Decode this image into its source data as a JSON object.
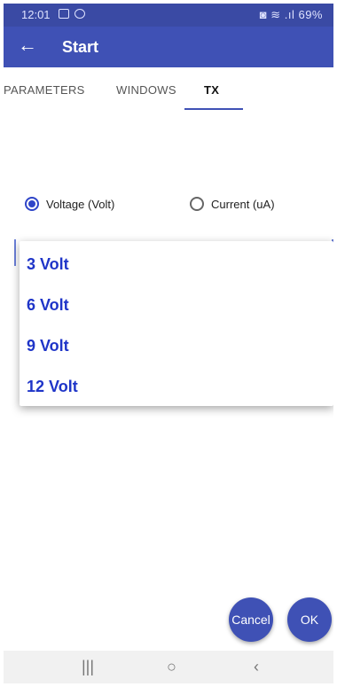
{
  "status_bar": {
    "time": "12:01",
    "right_text": "◙ ≋ .ıl 69%"
  },
  "app_bar": {
    "back_icon": "←",
    "title": "Start"
  },
  "tabs": [
    {
      "label": "PARAMETERS",
      "active": false
    },
    {
      "label": "WINDOWS",
      "active": false
    },
    {
      "label": "TX",
      "active": true
    }
  ],
  "radios": {
    "voltage": {
      "label": "Voltage (Volt)",
      "checked": true
    },
    "current": {
      "label": "Current (uA)",
      "checked": false
    }
  },
  "dropdown": {
    "options": [
      "3 Volt",
      "6 Volt",
      "9 Volt",
      "12 Volt"
    ]
  },
  "buttons": {
    "cancel": "Cancel",
    "ok": "OK"
  },
  "nav_bar": {
    "recent": "|||",
    "home": "○",
    "back": "‹"
  },
  "colors": {
    "primary": "#3f51b5",
    "status_bar": "#3a4aa4",
    "option_text": "#1f35c8"
  }
}
